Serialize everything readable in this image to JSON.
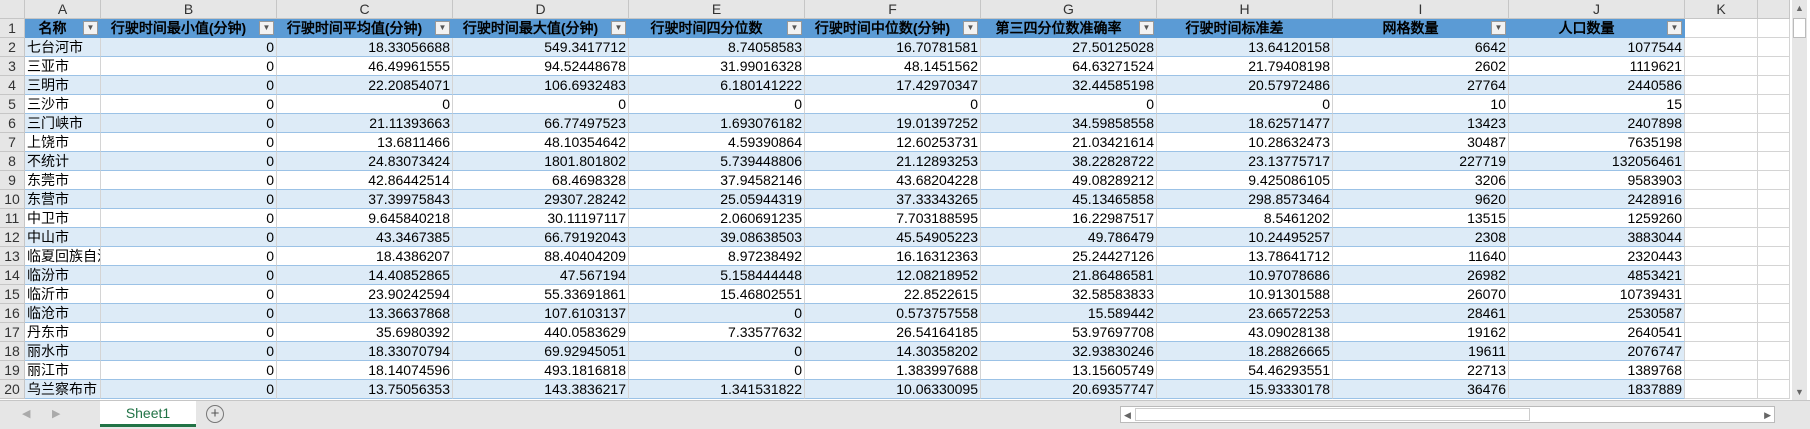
{
  "columns": [
    "A",
    "B",
    "C",
    "D",
    "E",
    "F",
    "G",
    "H",
    "I",
    "J",
    "K"
  ],
  "headers": [
    "名称",
    "行驶时间最小值(分钟)",
    "行驶时间平均值(分钟)",
    "行驶时间最大值(分钟)",
    "行驶时间四分位数",
    "行驶时间中位数(分钟)",
    "第三四分位数准确率",
    "行驶时间标准差",
    "网格数量",
    "人口数量"
  ],
  "rows": [
    [
      "七台河市",
      "0",
      "18.33056688",
      "549.3417712",
      "8.74058583",
      "16.70781581",
      "27.50125028",
      "13.64120158",
      "6642",
      "1077544"
    ],
    [
      "三亚市",
      "0",
      "46.49961555",
      "94.52448678",
      "31.99016328",
      "48.1451562",
      "64.63271524",
      "21.79408198",
      "2602",
      "1119621"
    ],
    [
      "三明市",
      "0",
      "22.20854071",
      "106.6932483",
      "6.180141222",
      "17.42970347",
      "32.44585198",
      "20.57972486",
      "27764",
      "2440586"
    ],
    [
      "三沙市",
      "0",
      "0",
      "0",
      "0",
      "0",
      "0",
      "0",
      "10",
      "15"
    ],
    [
      "三门峡市",
      "0",
      "21.11393663",
      "66.77497523",
      "1.693076182",
      "19.01397252",
      "34.59858558",
      "18.62571477",
      "13423",
      "2407898"
    ],
    [
      "上饶市",
      "0",
      "13.6811466",
      "48.10354642",
      "4.59390864",
      "12.60253731",
      "21.03421614",
      "10.28632473",
      "30487",
      "7635198"
    ],
    [
      "不统计",
      "0",
      "24.83073424",
      "1801.801802",
      "5.739448806",
      "21.12893253",
      "38.22828722",
      "23.13775717",
      "227719",
      "132056461"
    ],
    [
      "东莞市",
      "0",
      "42.86442514",
      "68.4698328",
      "37.94582146",
      "43.68204228",
      "49.08289212",
      "9.425086105",
      "3206",
      "9583903"
    ],
    [
      "东营市",
      "0",
      "37.39975843",
      "29307.28242",
      "25.05944319",
      "37.33343265",
      "45.13465858",
      "298.8573464",
      "9620",
      "2428916"
    ],
    [
      "中卫市",
      "0",
      "9.645840218",
      "30.11197117",
      "2.060691235",
      "7.703188595",
      "16.22987517",
      "8.5461202",
      "13515",
      "1259260"
    ],
    [
      "中山市",
      "0",
      "43.3467385",
      "66.79192043",
      "39.08638503",
      "45.54905223",
      "49.786479",
      "10.24495257",
      "2308",
      "3883044"
    ],
    [
      "临夏回族自治州",
      "0",
      "18.4386207",
      "88.40404209",
      "8.97238492",
      "16.16312363",
      "25.24427126",
      "13.78641712",
      "11640",
      "2320443"
    ],
    [
      "临汾市",
      "0",
      "14.40852865",
      "47.567194",
      "5.158444448",
      "12.08218952",
      "21.86486581",
      "10.97078686",
      "26982",
      "4853421"
    ],
    [
      "临沂市",
      "0",
      "23.90242594",
      "55.33691861",
      "15.46802551",
      "22.8522615",
      "32.58583833",
      "10.91301588",
      "26070",
      "10739431"
    ],
    [
      "临沧市",
      "0",
      "13.36637868",
      "107.6103137",
      "0",
      "0.573757558",
      "15.589442",
      "23.66572253",
      "28461",
      "2530587"
    ],
    [
      "丹东市",
      "0",
      "35.6980392",
      "440.0583629",
      "7.33577632",
      "26.54164185",
      "53.97697708",
      "43.09028138",
      "19162",
      "2640541"
    ],
    [
      "丽水市",
      "0",
      "18.33070794",
      "69.92945051",
      "0",
      "14.30358202",
      "32.93830246",
      "18.28826665",
      "19611",
      "2076747"
    ],
    [
      "丽江市",
      "0",
      "18.14074596",
      "493.1816818",
      "0",
      "1.383997688",
      "13.15605749",
      "54.46293551",
      "22713",
      "1389768"
    ],
    [
      "乌兰察布市",
      "0",
      "13.75056353",
      "143.3836217",
      "1.341531822",
      "10.06330095",
      "20.69357747",
      "15.93330178",
      "36476",
      "1837889"
    ]
  ],
  "sheet_tab": "Sheet1"
}
